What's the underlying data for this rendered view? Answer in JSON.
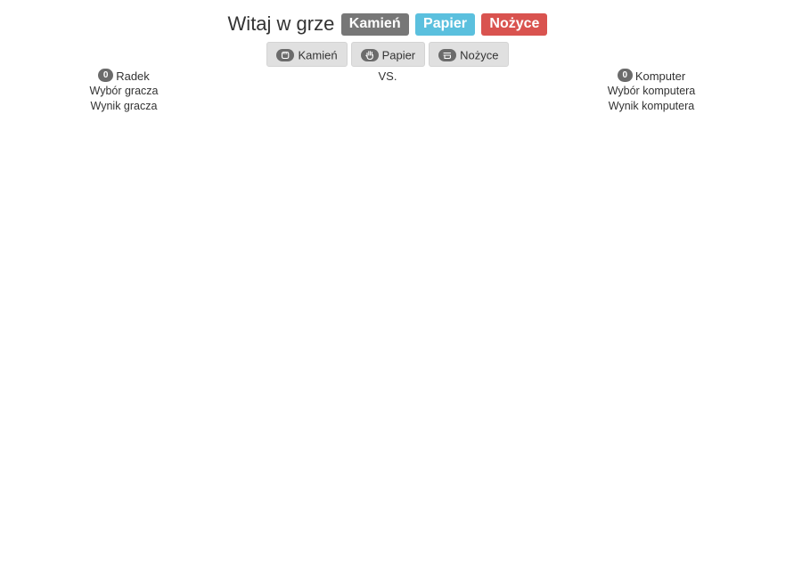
{
  "header": {
    "title": "Witaj w grze",
    "badges": [
      {
        "label": "Kamień",
        "color": "#777777"
      },
      {
        "label": "Papier",
        "color": "#5bc0de"
      },
      {
        "label": "Nożyce",
        "color": "#d9534f"
      }
    ]
  },
  "moves": [
    {
      "label": "Kamień",
      "icon": "rock-hand-icon"
    },
    {
      "label": "Papier",
      "icon": "paper-hand-icon"
    },
    {
      "label": "Nożyce",
      "icon": "scissors-hand-icon"
    }
  ],
  "vs_label": "VS.",
  "player": {
    "score": "0",
    "name": "Radek",
    "choice_label": "Wybór gracza",
    "result_label": "Wynik gracza"
  },
  "computer": {
    "score": "0",
    "name": "Komputer",
    "choice_label": "Wybór komputera",
    "result_label": "Wynik komputera"
  },
  "colors": {
    "badge_grey": "#777777",
    "badge_blue": "#5bc0de",
    "badge_red": "#d9534f",
    "button_bg": "#e0e0e0"
  }
}
